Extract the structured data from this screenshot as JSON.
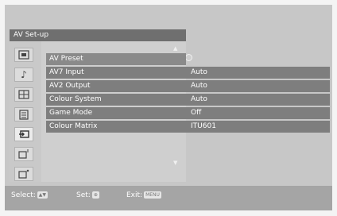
{
  "menu": {
    "title": "AV Set-up",
    "icons": [
      {
        "name": "picture-icon",
        "glyph": ""
      },
      {
        "name": "sound-icon",
        "glyph": "♪"
      },
      {
        "name": "screen-icon",
        "glyph": ""
      },
      {
        "name": "features-icon",
        "glyph": ""
      },
      {
        "name": "av-setup-icon",
        "glyph": ""
      },
      {
        "name": "pc-settings-icon",
        "glyph": ""
      },
      {
        "name": "setup-icon",
        "glyph": ""
      }
    ],
    "items": [
      {
        "label": "AV Preset",
        "value": ""
      },
      {
        "label": "AV7 Input",
        "value": "Auto"
      },
      {
        "label": "AV2 Output",
        "value": "Auto"
      },
      {
        "label": "Colour System",
        "value": "Auto"
      },
      {
        "label": "Game Mode",
        "value": "Off"
      },
      {
        "label": "Colour Matrix",
        "value": "ITU601"
      }
    ]
  },
  "footer": {
    "select_label": "Select:",
    "set_label": "Set:",
    "exit_label": "Exit:",
    "exit_key": "MENU"
  }
}
